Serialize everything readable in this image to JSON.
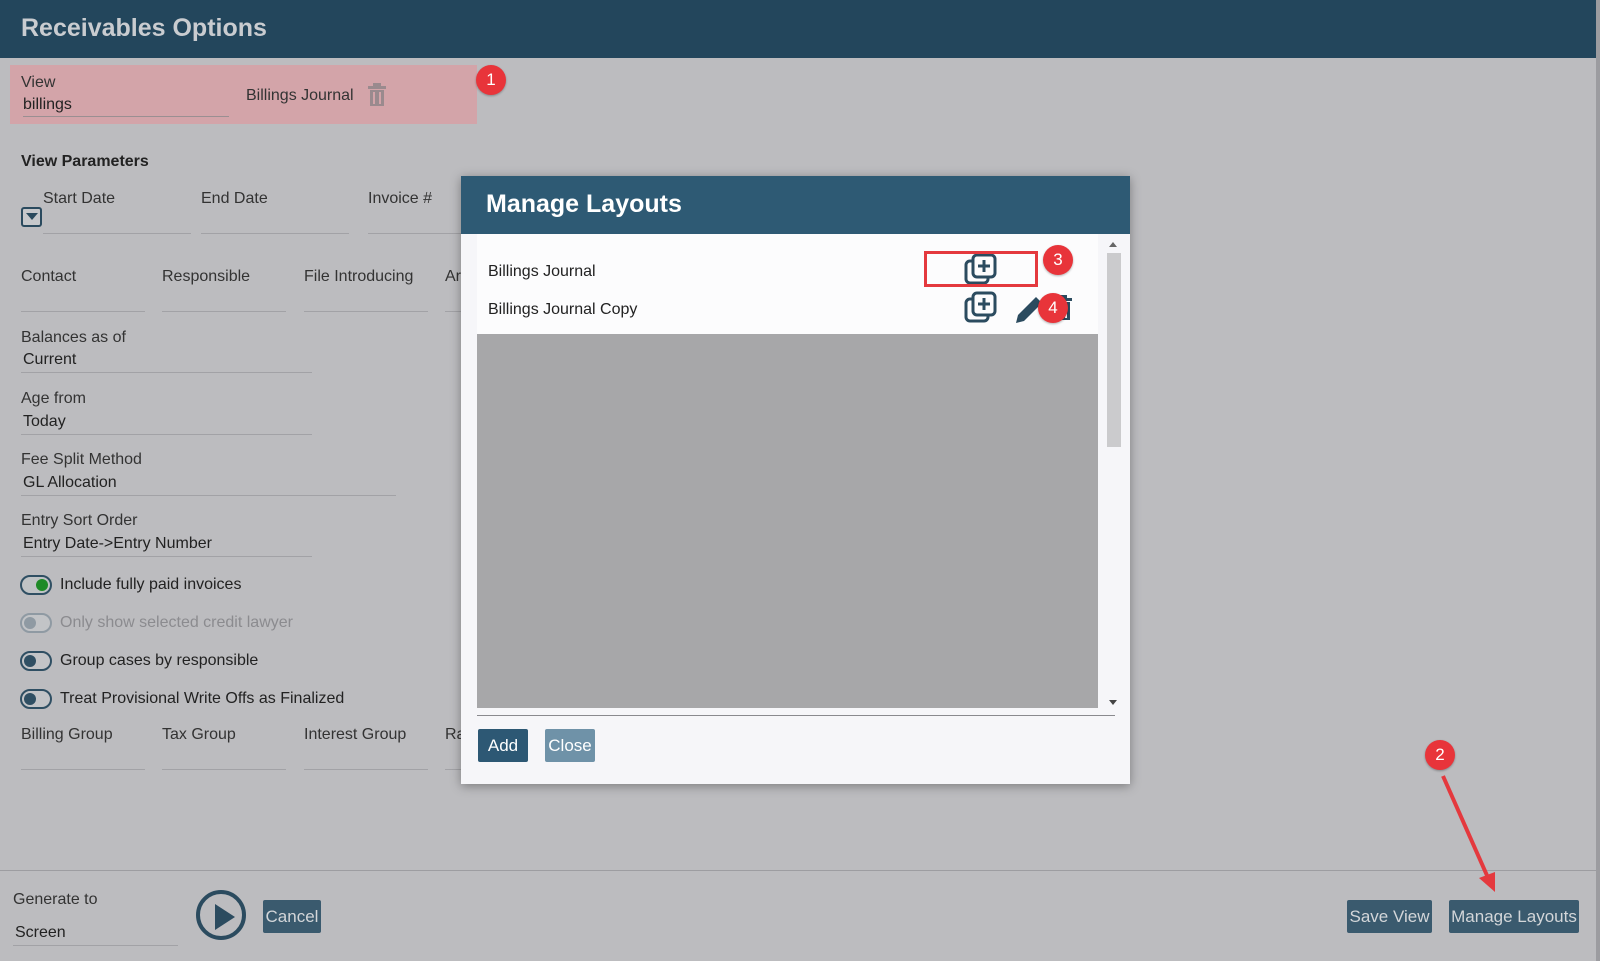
{
  "app": {
    "title": "Receivables Options"
  },
  "view": {
    "label": "View",
    "value": "billings",
    "layout_name": "Billings Journal",
    "delete_icon": "trash-icon"
  },
  "annotations": [
    "1",
    "2",
    "3",
    "4"
  ],
  "view_parameters": {
    "title": "View Parameters",
    "row1": [
      "Start Date",
      "End Date",
      "Invoice #"
    ],
    "row2": [
      "Contact",
      "Responsible",
      "File Introducing",
      "Ar"
    ],
    "balances": {
      "label": "Balances as of",
      "value": "Current"
    },
    "age_from": {
      "label": "Age from",
      "value": "Today"
    },
    "fee_split": {
      "label": "Fee Split Method",
      "value": "GL Allocation"
    },
    "sort_order": {
      "label": "Entry Sort Order",
      "value": "Entry Date->Entry Number"
    },
    "toggles": [
      {
        "label": "Include fully paid invoices",
        "state": "on"
      },
      {
        "label": "Only show selected credit lawyer",
        "state": "disabled"
      },
      {
        "label": "Group cases by responsible",
        "state": "off"
      },
      {
        "label": "Treat Provisional Write Offs as Finalized",
        "state": "off"
      }
    ],
    "row3": [
      "Billing Group",
      "Tax Group",
      "Interest Group",
      "Ra"
    ]
  },
  "bottom": {
    "generate_label": "Generate to",
    "generate_value": "Screen",
    "cancel": "Cancel",
    "save_view": "Save View",
    "manage_layouts": "Manage Layouts"
  },
  "modal": {
    "title": "Manage Layouts",
    "layouts": [
      {
        "name": "Billings Journal",
        "actions": [
          "copy-icon"
        ]
      },
      {
        "name": "Billings Journal Copy",
        "actions": [
          "copy-icon",
          "pencil-icon",
          "trash-icon"
        ]
      }
    ],
    "add": "Add",
    "close": "Close"
  },
  "colors": {
    "header": "#23465c",
    "modal_header": "#2e5a74",
    "badge": "#e8343a",
    "toggle_on": "#1e8a27"
  }
}
